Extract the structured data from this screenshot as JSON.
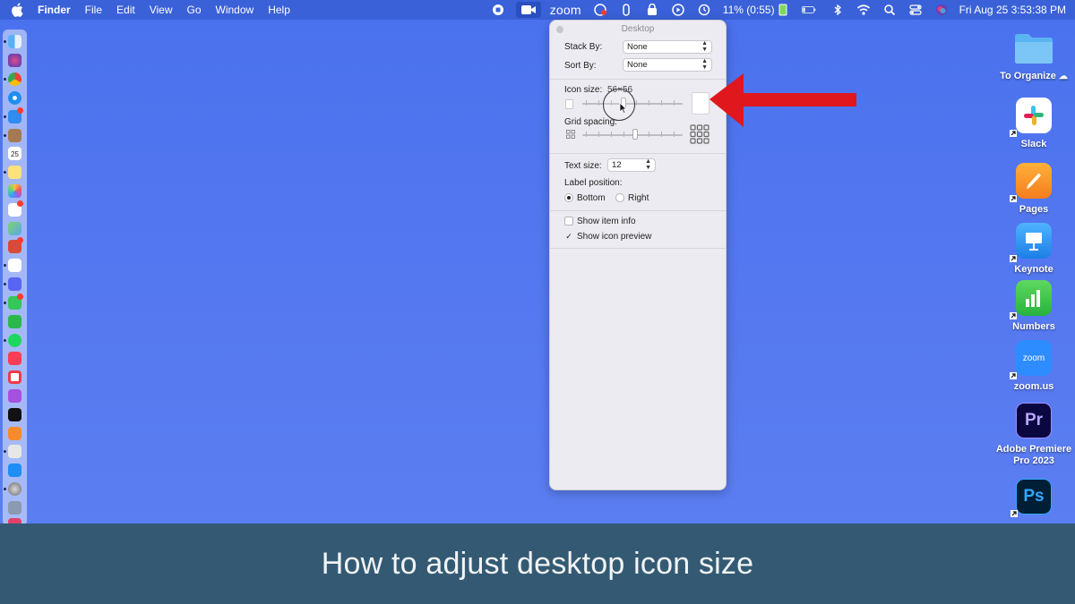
{
  "menubar": {
    "app_name": "Finder",
    "menus": [
      "File",
      "Edit",
      "View",
      "Go",
      "Window",
      "Help"
    ],
    "zoom_word": "zoom",
    "battery_text": "11% (0:55)",
    "datetime": "Fri Aug 25  3:53:38 PM"
  },
  "panel": {
    "title": "Desktop",
    "stack_by_label": "Stack By:",
    "stack_by_value": "None",
    "sort_by_label": "Sort By:",
    "sort_by_value": "None",
    "icon_size_label": "Icon size:",
    "icon_size_value": "56×56",
    "grid_spacing_label": "Grid spacing:",
    "text_size_label": "Text size:",
    "text_size_value": "12",
    "label_position_label": "Label position:",
    "label_bottom": "Bottom",
    "label_right": "Right",
    "show_item_info": "Show item info",
    "show_icon_preview": "Show icon preview",
    "checked_mark": "✓"
  },
  "desktop_icons": [
    {
      "label": "To Organize",
      "icon": "folder-icon"
    },
    {
      "label": "Slack",
      "icon": "slack-icon"
    },
    {
      "label": "Pages",
      "icon": "pages-icon"
    },
    {
      "label": "Keynote",
      "icon": "keynote-icon"
    },
    {
      "label": "Numbers",
      "icon": "numbers-icon"
    },
    {
      "label": "zoom.us",
      "icon": "zoom-icon",
      "glyph": "zoom"
    },
    {
      "label": "Adobe Premiere Pro 2023",
      "icon": "premiere-icon",
      "glyph": "Pr"
    },
    {
      "label": "",
      "icon": "photoshop-icon",
      "glyph": "Ps"
    }
  ],
  "dock": {
    "calendar_day": "25"
  },
  "caption": "How to adjust desktop icon size",
  "colors": {
    "desktop": "#4f75ef",
    "annotation_arrow": "#e0181e",
    "caption_bar": "#345a73"
  }
}
